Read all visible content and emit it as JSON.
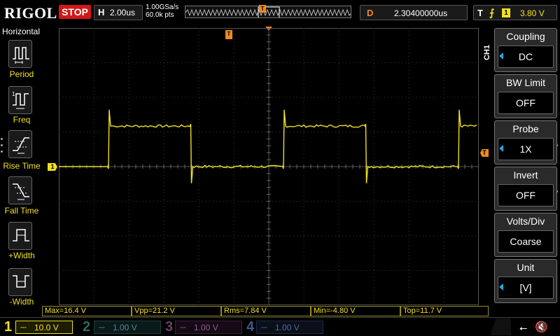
{
  "top": {
    "brand": "RIGOL",
    "run_status": "STOP",
    "horizontal_label": "H",
    "timebase": "2.00us",
    "sample_rate": "1.00GSa/s",
    "memory_depth": "60.0k pts",
    "trigger_pos_marker": "T",
    "delay_label": "D",
    "delay_value": "2.30400000us",
    "trigger_label": "T",
    "trigger_slope_icon": "rising-edge-icon",
    "trigger_source": "1",
    "trigger_level": "3.80 V"
  },
  "left_menu": {
    "title": "Horizontal",
    "items": [
      {
        "label": "Period",
        "icon": "period-icon"
      },
      {
        "label": "Freq",
        "icon": "freq-icon"
      },
      {
        "label": "Rise Time",
        "icon": "rise-time-icon"
      },
      {
        "label": "Fall Time",
        "icon": "fall-time-icon"
      },
      {
        "label": "+Width",
        "icon": "plus-width-icon"
      },
      {
        "label": "-Width",
        "icon": "minus-width-icon"
      }
    ]
  },
  "grid": {
    "ch1_marker": "1",
    "trigger_level_marker": "T",
    "trigger_pos_marker": "T"
  },
  "right_menu": {
    "channel_tab": "CH1",
    "items": [
      {
        "title": "Coupling",
        "value": "DC",
        "has_arrow": true
      },
      {
        "title": "BW Limit",
        "value": "OFF",
        "has_arrow": false
      },
      {
        "title": "Probe",
        "value": "1X",
        "has_arrow": true
      },
      {
        "title": "Invert",
        "value": "OFF",
        "has_arrow": false
      },
      {
        "title": "Volts/Div",
        "value": "Coarse",
        "has_arrow": false
      },
      {
        "title": "Unit",
        "value": "[V]",
        "has_arrow": true
      }
    ]
  },
  "measurements": [
    "Max=16.4 V",
    "Vpp=21.2 V",
    "Rms=7.84 V",
    "Min=-4.80 V",
    "Top=11.7 V"
  ],
  "channels": [
    {
      "num": "1",
      "scale": "10.0 V",
      "coupling_icon": "dc-coupling-icon",
      "active": true
    },
    {
      "num": "2",
      "scale": "1.00 V",
      "coupling_icon": "dc-coupling-icon",
      "active": false
    },
    {
      "num": "3",
      "scale": "1.00 V",
      "coupling_icon": "dc-coupling-icon",
      "active": false
    },
    {
      "num": "4",
      "scale": "1.00 V",
      "coupling_icon": "dc-coupling-icon",
      "active": false
    }
  ],
  "status_icons": [
    "usb-icon",
    "speaker-mute-icon"
  ],
  "colors": {
    "ch1": "#f0e020",
    "ch2": "#4f8a8a",
    "ch3": "#8a5f8a",
    "ch4": "#4f6a9a",
    "trigger": "#f08a1c",
    "stop": "#d01818",
    "menu_arrow": "#29a8e0"
  },
  "waveform": {
    "channel": "1",
    "shape": "square",
    "period_us": 10.0,
    "high_level_v": 11.7,
    "low_level_v": 0.0,
    "overshoot_max_v": 16.4,
    "undershoot_min_v": -4.8,
    "first_rising_edge_div": 1.4,
    "duty_cycle": 0.47
  }
}
